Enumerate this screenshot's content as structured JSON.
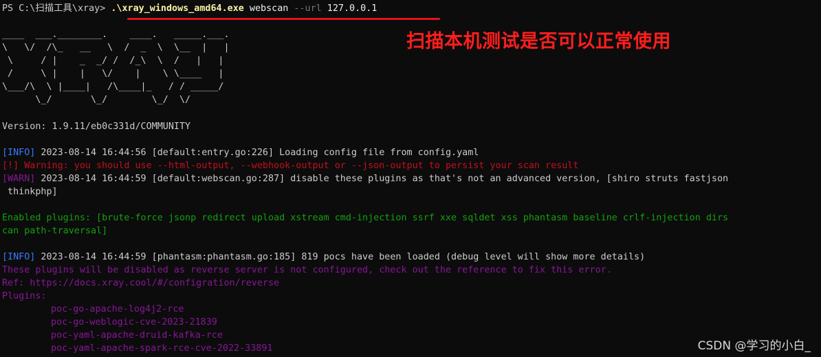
{
  "prompt": {
    "prefix": "PS C:\\扫描工具\\xray> ",
    "executable": ".\\xray_windows_amd64.exe",
    "subcommand": " webscan ",
    "flag": "--url",
    "target": " 127.0.0.1"
  },
  "banner": [
    "____  ___.________.    ____.   _____.___.",
    "\\   \\/  /\\_   __   \\  /  _  \\  \\__  |   |",
    " \\     / |    _  _/ /  /_\\  \\  /   |   |",
    " /     \\ |    |   \\/    |    \\ \\____   |",
    "\\___/\\  \\ |____|   /\\____|_   / / _____/",
    "      \\_/       \\_/        \\_/  \\/"
  ],
  "version": "Version: 1.9.11/eb0c331d/COMMUNITY",
  "log": {
    "info1_tag": "[INFO]",
    "info1_text": " 2023-08-14 16:44:56 [default:entry.go:226] Loading config file from config.yaml",
    "warning": "[!] Warning: you should use --html-output, --webhook-output or --json-output to persist your scan result",
    "warn_tag": "[WARN]",
    "warn_text": " 2023-08-14 16:44:59 [default:webscan.go:287] disable these plugins as that's not an advanced version, [shiro struts fastjson",
    "warn_cont": " thinkphp]",
    "enabled_line1": "Enabled plugins: [brute-force jsonp redirect upload xstream cmd-injection ssrf xxe sqldet xss phantasm baseline crlf-injection dirs",
    "enabled_line2": "can path-traversal]",
    "info2_tag": "[INFO]",
    "info2_text": " 2023-08-14 16:44:59 [phantasm:phantasm.go:185] 819 pocs have been loaded (debug level will show more details)",
    "disabled_note": "These plugins will be disabled as reverse server is not configured, check out the reference to fix this error.",
    "ref": "Ref: https://docs.xray.cool/#/configration/reverse",
    "plugins_label": "Plugins:",
    "plugins": [
      "poc-go-apache-log4j2-rce",
      "poc-go-weblogic-cve-2023-21839",
      "poc-yaml-apache-druid-kafka-rce",
      "poc-yaml-apache-spark-rce-cve-2022-33891"
    ]
  },
  "annotation": "扫描本机测试是否可以正常使用",
  "watermark": "CSDN @学习的小白_",
  "colors": {
    "background": "#0c0c0c",
    "info": "#3b78ff",
    "error": "#c50f1f",
    "success": "#13a10e",
    "notice": "#881798",
    "annotation": "#ff1e1e"
  }
}
